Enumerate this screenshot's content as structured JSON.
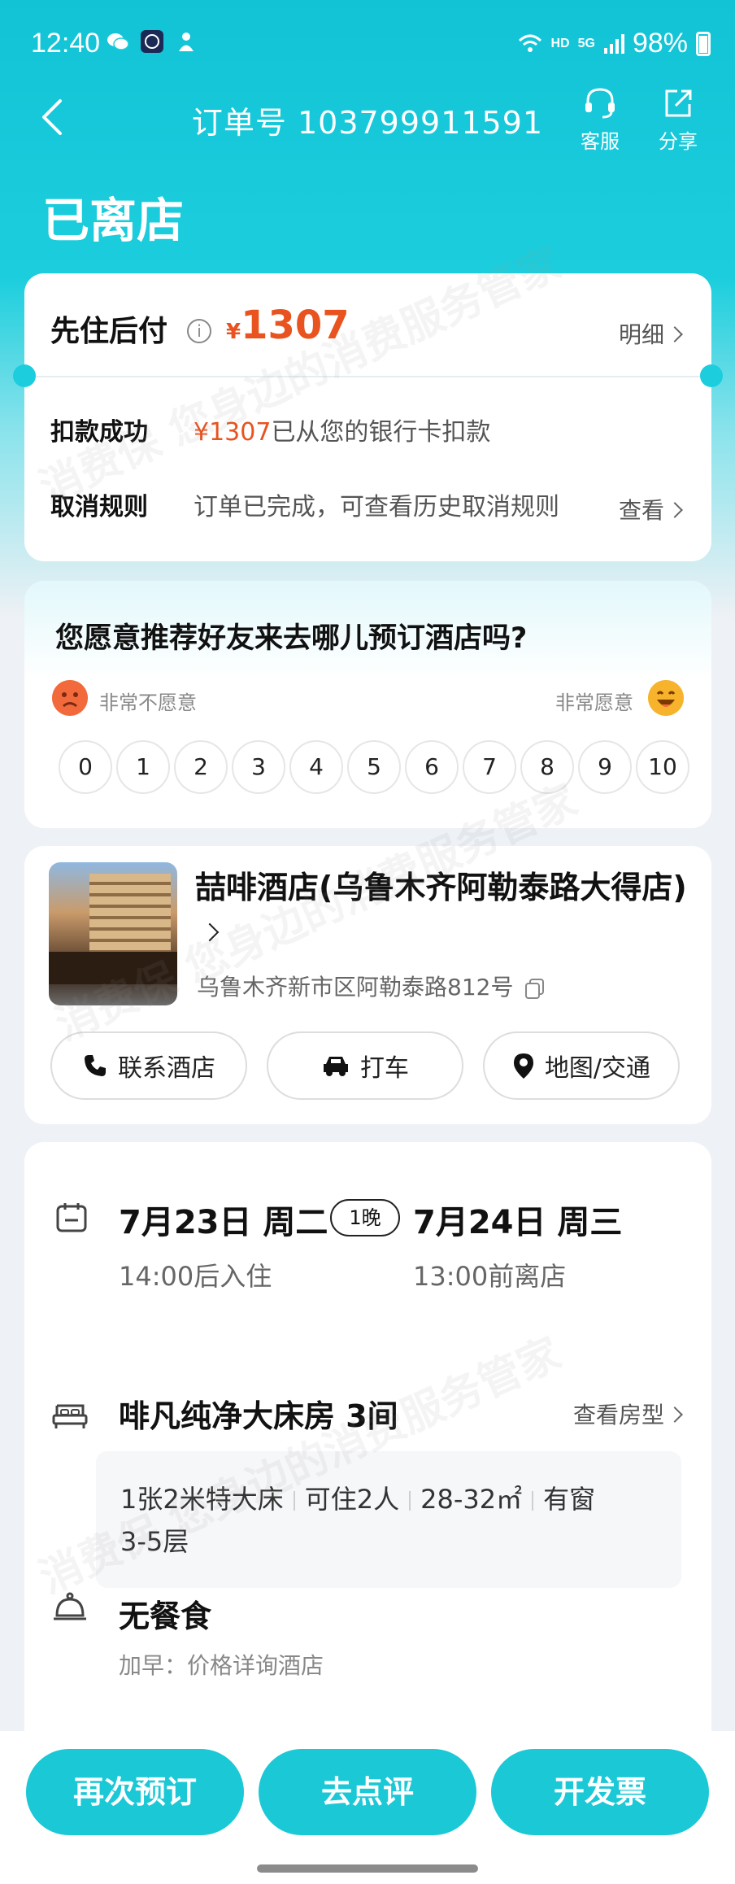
{
  "status_bar": {
    "time": "12:40",
    "hd": "HD",
    "net": "5G",
    "battery": "98%"
  },
  "nav": {
    "order_label": "订单号 103799911591",
    "cs_label": "客服",
    "share_label": "分享"
  },
  "page_status": "已离店",
  "payment": {
    "title": "先住后付",
    "currency": "¥",
    "amount": "1307",
    "detail_link": "明细",
    "rows": [
      {
        "label": "扣款成功",
        "accent": "¥1307",
        "text": "已从您的银行卡扣款"
      },
      {
        "label": "取消规则",
        "text": "订单已完成，可查看历史取消规则",
        "link": "查看"
      }
    ]
  },
  "survey": {
    "question": "您愿意推荐好友来去哪儿预订酒店吗?",
    "low_label": "非常不愿意",
    "high_label": "非常愿意",
    "scale": [
      "0",
      "1",
      "2",
      "3",
      "4",
      "5",
      "6",
      "7",
      "8",
      "9",
      "10"
    ]
  },
  "hotel": {
    "name": "喆啡酒店(乌鲁木齐阿勒泰路大得店)",
    "address": "乌鲁木齐新市区阿勒泰路812号",
    "actions": [
      {
        "label": "联系酒店",
        "icon": "phone-icon"
      },
      {
        "label": "打车",
        "icon": "car-icon"
      },
      {
        "label": "地图/交通",
        "icon": "map-pin-icon"
      }
    ]
  },
  "stay": {
    "checkin_date": "7月23日 周二",
    "nights": "1晚",
    "checkout_date": "7月24日 周三",
    "checkin_note": "14:00后入住",
    "checkout_note": "13:00前离店"
  },
  "room": {
    "name": "啡凡纯净大床房  3间",
    "link": "查看房型",
    "features_line1": [
      "1张2米特大床",
      "可住2人",
      "28-32㎡",
      "有窗"
    ],
    "features_line2": "3-5层"
  },
  "meal": {
    "title": "无餐食",
    "note": "加早：价格详询酒店"
  },
  "bottom": {
    "rebook": "再次预订",
    "review": "去点评",
    "invoice": "开发票"
  },
  "watermark": "消费保 您身边的消费服务管家",
  "colors": {
    "accent": "#1bc8d6",
    "price": "#e8531f"
  }
}
